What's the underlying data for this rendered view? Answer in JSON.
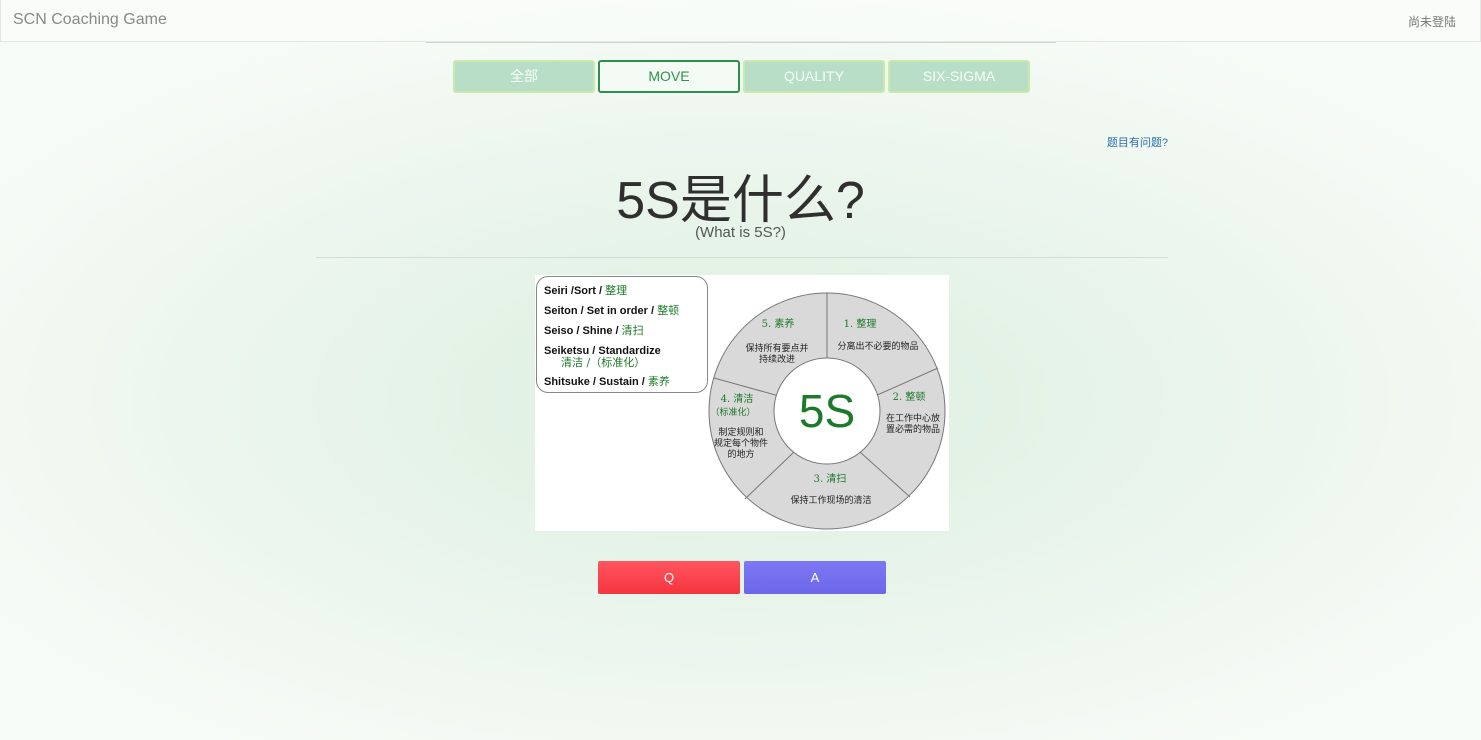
{
  "header": {
    "brand": "SCN Coaching Game",
    "login_status": "尚未登陆"
  },
  "tabs": [
    {
      "label": "全部",
      "active": false
    },
    {
      "label": "MOVE",
      "active": true
    },
    {
      "label": "QUALITY",
      "active": false
    },
    {
      "label": "SIX-SIGMA",
      "active": false
    }
  ],
  "report_link": "题目有问题?",
  "question": {
    "title": "5S是什么?",
    "subtitle": "(What is 5S?)"
  },
  "figure": {
    "legend": [
      {
        "en": "Seiri /Sort / ",
        "cn": "整理"
      },
      {
        "en": "Seiton / Set in order / ",
        "cn": "整顿"
      },
      {
        "en": "Seiso / Shine / ",
        "cn": "清扫"
      },
      {
        "en": "Seiketsu / Standardize",
        "cn": "清洁 /（标准化）"
      },
      {
        "en": "Shitsuke / Sustain / ",
        "cn": "素养"
      }
    ],
    "center_label": "5S",
    "segments": [
      {
        "heading": "1. 整理",
        "lines": [
          "分离出不必要的物品"
        ]
      },
      {
        "heading": "2. 整顿",
        "lines": [
          "在工作中心放",
          "置必需的物品"
        ]
      },
      {
        "heading": "3. 清扫",
        "lines": [
          "保持工作现场的清洁"
        ]
      },
      {
        "heading": "4. 清洁",
        "sub": "（标准化）",
        "lines": [
          "制定规则和",
          "规定每个物件",
          "的地方"
        ]
      },
      {
        "heading": "5. 素养",
        "lines": [
          "保持所有要点并",
          "持续改进"
        ]
      }
    ],
    "colors": {
      "accent_green": "#1d7a2a",
      "wheel_fill": "#d9d9d9"
    }
  },
  "actions": {
    "q_label": "Q",
    "a_label": "A"
  },
  "colors": {
    "q_button": "#f5343e",
    "a_button": "#6c67e8",
    "tab_active": "#2f8f4e"
  }
}
